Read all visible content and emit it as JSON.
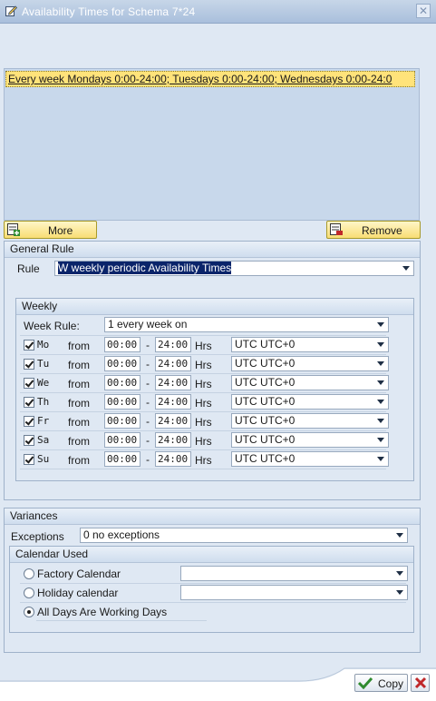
{
  "window": {
    "title": "Availability Times for Schema 7*24"
  },
  "rule_list": {
    "entries": [
      "Every week Mondays  0:00-24:00; Tuesdays  0:00-24:00; Wednesdays  0:00-24:0"
    ]
  },
  "toolbar": {
    "more_label": "More",
    "remove_label": "Remove"
  },
  "general_rule": {
    "header": "General Rule",
    "rule_label": "Rule",
    "rule_value": "W weekly periodic Availability Times"
  },
  "weekly": {
    "header": "Weekly",
    "week_rule_label": "Week Rule:",
    "week_rule_value": "1 every week on",
    "from_label": "from",
    "dash": "-",
    "hrs_label": "Hrs",
    "days": [
      {
        "abbr": "Mo",
        "checked": true,
        "from": "00:00",
        "to": "24:00",
        "tz": "UTC UTC+0"
      },
      {
        "abbr": "Tu",
        "checked": true,
        "from": "00:00",
        "to": "24:00",
        "tz": "UTC UTC+0"
      },
      {
        "abbr": "We",
        "checked": true,
        "from": "00:00",
        "to": "24:00",
        "tz": "UTC UTC+0"
      },
      {
        "abbr": "Th",
        "checked": true,
        "from": "00:00",
        "to": "24:00",
        "tz": "UTC UTC+0"
      },
      {
        "abbr": "Fr",
        "checked": true,
        "from": "00:00",
        "to": "24:00",
        "tz": "UTC UTC+0"
      },
      {
        "abbr": "Sa",
        "checked": true,
        "from": "00:00",
        "to": "24:00",
        "tz": "UTC UTC+0"
      },
      {
        "abbr": "Su",
        "checked": true,
        "from": "00:00",
        "to": "24:00",
        "tz": "UTC UTC+0"
      }
    ]
  },
  "variances": {
    "header": "Variances",
    "exceptions_label": "Exceptions",
    "exceptions_value": "0 no exceptions",
    "calendar": {
      "header": "Calendar Used",
      "factory_label": "Factory Calendar",
      "factory_value": "",
      "holiday_label": "Holiday calendar",
      "holiday_value": "",
      "all_days_label": "All Days Are Working Days",
      "selected": "all_days"
    }
  },
  "footer": {
    "copy_label": "Copy"
  },
  "colors": {
    "highlight_row": "#ffe37a",
    "selection": "#0a246a",
    "panel_bg": "#dfe8f3"
  }
}
